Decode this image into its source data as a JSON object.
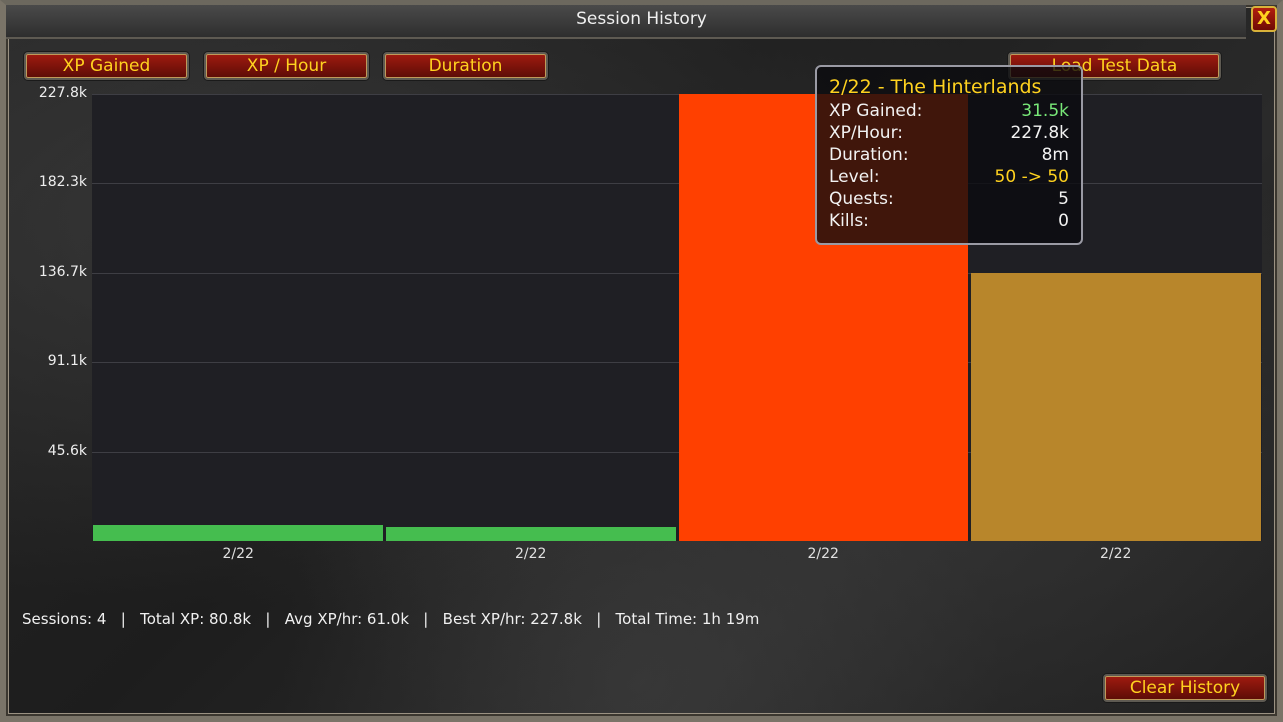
{
  "window": {
    "title": "Session History",
    "close_label": "X"
  },
  "toolbar": {
    "xp_gained": "XP Gained",
    "xp_hour": "XP / Hour",
    "duration": "Duration",
    "load_test": "Load Test Data"
  },
  "chart_data": {
    "type": "bar",
    "categories": [
      "2/22",
      "2/22",
      "2/22",
      "2/22"
    ],
    "values": [
      8.2,
      7.3,
      227.8,
      136.7
    ],
    "bar_colors": [
      "#45bd4f",
      "#45bd4f",
      "#ff4000",
      "#b8862b"
    ],
    "y_ticks": [
      "227.8k",
      "182.3k",
      "136.7k",
      "91.1k",
      "45.6k"
    ],
    "y_tick_values": [
      227.8,
      182.3,
      136.7,
      91.1,
      45.6
    ],
    "ylim": [
      0,
      227.8
    ],
    "ylabel": "",
    "xlabel": "",
    "grid": true
  },
  "tooltip": {
    "title": "2/22 - The Hinterlands",
    "rows": [
      {
        "label": "XP Gained:",
        "value": "31.5k",
        "color": "#78e878"
      },
      {
        "label": "XP/Hour:",
        "value": "227.8k",
        "color": "#f2f2f2"
      },
      {
        "label": "Duration:",
        "value": "8m",
        "color": "#f2f2f2"
      },
      {
        "label": "Level:",
        "value": "50 -> 50",
        "color": "#ffd21f"
      },
      {
        "label": "Quests:",
        "value": "5",
        "color": "#f2f2f2"
      },
      {
        "label": "Kills:",
        "value": "0",
        "color": "#f2f2f2"
      }
    ]
  },
  "stats": "Sessions: 4   |   Total XP: 80.8k   |   Avg XP/hr: 61.0k   |   Best XP/hr: 227.8k   |   Total Time: 1h 19m",
  "footer": {
    "clear_history": "Clear History"
  }
}
